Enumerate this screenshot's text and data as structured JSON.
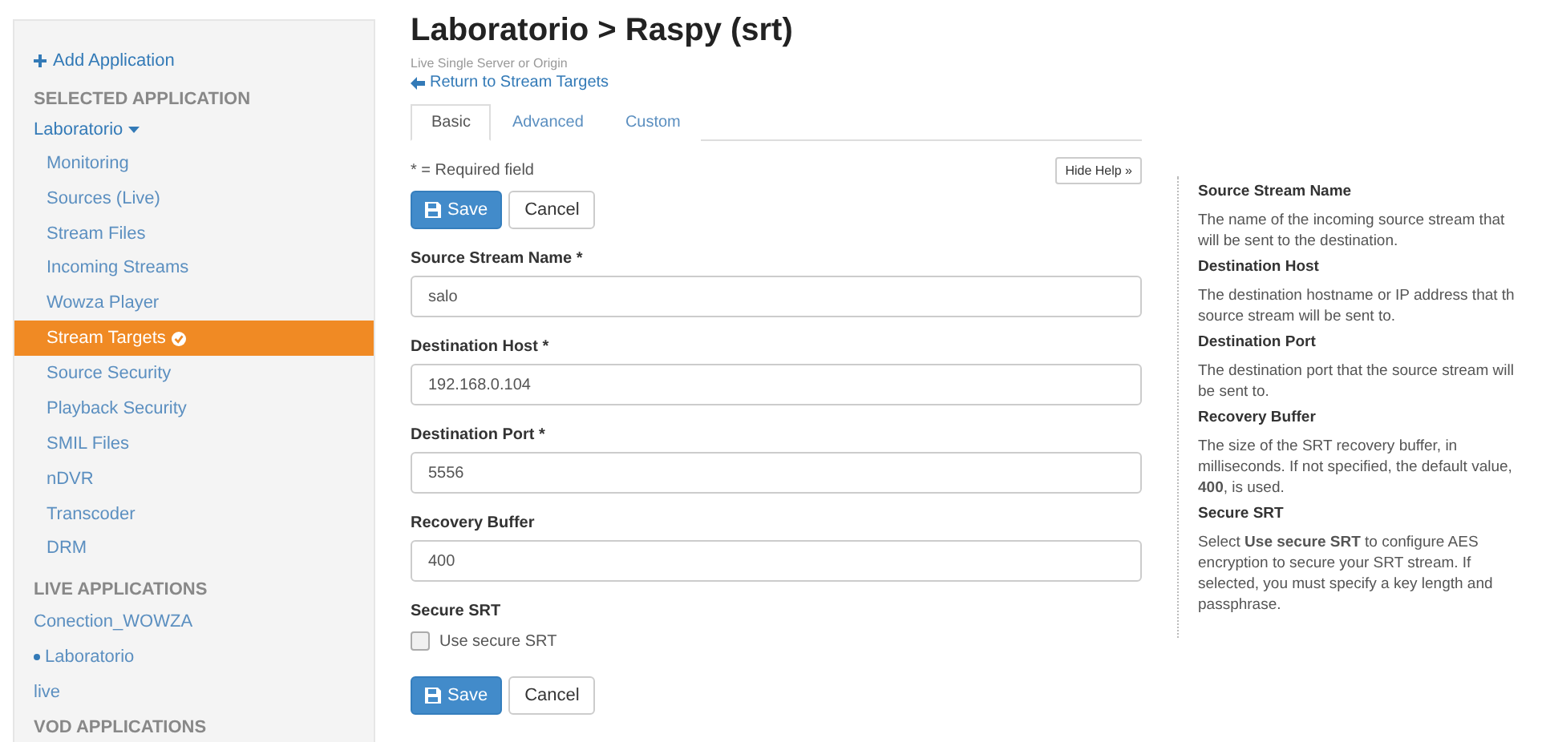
{
  "sidebar": {
    "add_link": "Add Application",
    "selected_header": "SELECTED APPLICATION",
    "app_name": "Laboratorio",
    "items": [
      {
        "label": "Monitoring",
        "selected": false
      },
      {
        "label": "Sources (Live)",
        "selected": false
      },
      {
        "label": "Stream Files",
        "selected": false
      },
      {
        "label": "Incoming Streams",
        "selected": false
      },
      {
        "label": "Wowza Player",
        "selected": false
      },
      {
        "label": "Stream Targets",
        "selected": true
      },
      {
        "label": "Source Security",
        "selected": false
      },
      {
        "label": "Playback Security",
        "selected": false
      },
      {
        "label": "SMIL Files",
        "selected": false
      },
      {
        "label": "nDVR",
        "selected": false
      },
      {
        "label": "Transcoder",
        "selected": false
      },
      {
        "label": "DRM",
        "selected": false
      }
    ],
    "live_header": "LIVE APPLICATIONS",
    "live_apps": [
      {
        "label": "Conection_WOWZA",
        "current": false
      },
      {
        "label": "Laboratorio",
        "current": true
      },
      {
        "label": "live",
        "current": false
      }
    ],
    "vod_header": "VOD APPLICATIONS"
  },
  "title": "Laboratorio > Raspy (srt)",
  "subtitle": "Live Single Server or Origin",
  "back_link": "Return to Stream Targets",
  "tabs": [
    {
      "label": "Basic",
      "selected": true
    },
    {
      "label": "Advanced",
      "selected": false
    },
    {
      "label": "Custom",
      "selected": false
    }
  ],
  "required_note": "* = Required field",
  "hide_help": "Hide Help »",
  "button_rows": [
    {
      "save": "Save",
      "cancel": "Cancel"
    },
    {
      "save": "Save",
      "cancel": "Cancel"
    }
  ],
  "fields": [
    {
      "label": "Source Stream Name",
      "required_mark": "*",
      "value": "salo"
    },
    {
      "label": "Destination Host",
      "required_mark": "*",
      "value": "192.168.0.104"
    },
    {
      "label": "Destination Port",
      "required_mark": "*",
      "value": "5556"
    },
    {
      "label": "Recovery Buffer",
      "value": "400"
    }
  ],
  "secure": {
    "label": "Secure SRT",
    "option": "Use secure SRT",
    "checked": false
  },
  "help": [
    {
      "title": "Source Stream Name",
      "text": "The name of the incoming source stream that will be sent to the destination."
    },
    {
      "title": "Destination Host",
      "text": "The destination hostname or IP address that th source stream will be sent to."
    },
    {
      "title": "Destination Port",
      "text": "The destination port that the source stream will be sent to."
    },
    {
      "title": "Recovery Buffer",
      "text": "The size of the SRT recovery buffer, in milliseconds. If not specified, the default value, **400**, is used."
    },
    {
      "title": "Secure SRT",
      "text": "Select **Use secure SRT** to configure AES encryption to secure your SRT stream. If selected, you must specify a key length and passphrase."
    }
  ]
}
